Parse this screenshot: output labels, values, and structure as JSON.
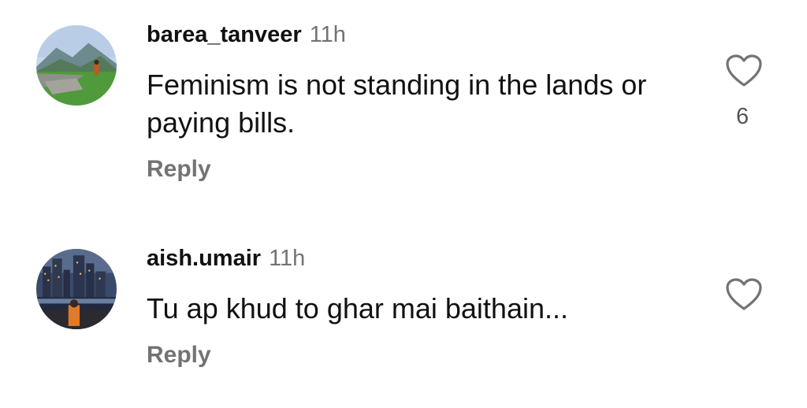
{
  "comments": [
    {
      "username": "barea_tanveer",
      "time": "11h",
      "text": "Feminism is not standing in the lands or paying bills.",
      "reply_label": "Reply",
      "like_count": "6",
      "like_icon": "heart-outline-icon",
      "avatar": "mountain-landscape-avatar"
    },
    {
      "username": "aish.umair",
      "time": "11h",
      "text": "Tu ap khud to ghar mai baithain...",
      "reply_label": "Reply",
      "like_icon": "heart-outline-icon",
      "avatar": "city-night-avatar"
    }
  ],
  "colors": {
    "text": "#111111",
    "secondary": "#737373",
    "background": "#ffffff"
  }
}
